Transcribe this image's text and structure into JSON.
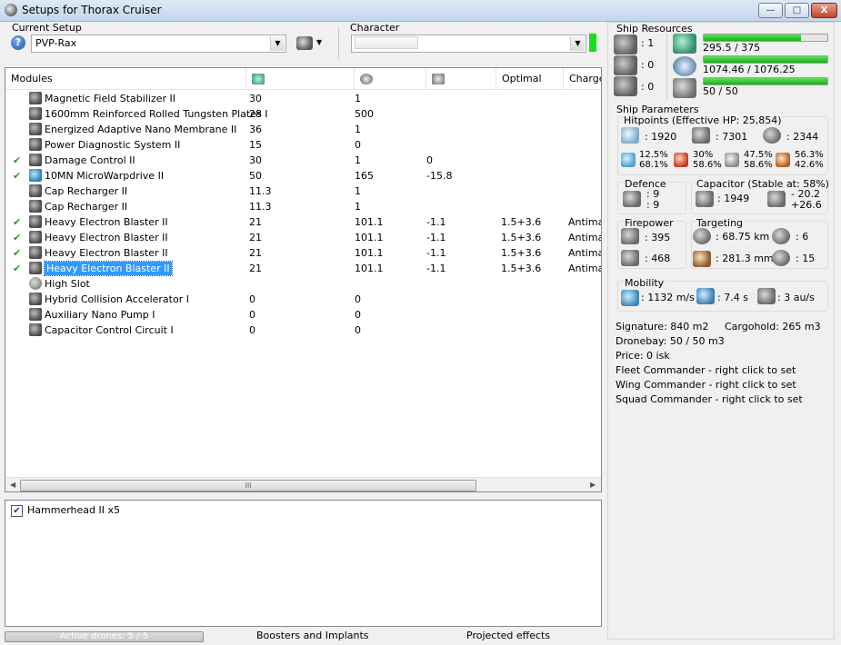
{
  "window": {
    "title": "Setups for Thorax Cruiser",
    "min_label": "—",
    "max_label": "□",
    "close_label": "X"
  },
  "setup": {
    "label": "Current Setup",
    "value": "PVP-Rax"
  },
  "character": {
    "label": "Character",
    "value": ""
  },
  "modules": {
    "columns": [
      "Modules",
      "",
      "",
      "",
      "Optimal",
      "Charge"
    ],
    "rows": [
      {
        "check": "",
        "name": "Magnetic Field Stabilizer II",
        "c1": "30",
        "c2": "1",
        "c3": "",
        "opt": "",
        "charge": "",
        "icon": "mag-stab-icon"
      },
      {
        "check": "",
        "name": "1600mm Reinforced Rolled Tungsten Plates I",
        "c1": "28",
        "c2": "500",
        "c3": "",
        "opt": "",
        "charge": "",
        "icon": "armor-plate-icon"
      },
      {
        "check": "",
        "name": "Energized Adaptive Nano Membrane II",
        "c1": "36",
        "c2": "1",
        "c3": "",
        "opt": "",
        "charge": "",
        "icon": "membrane-icon"
      },
      {
        "check": "",
        "name": "Power Diagnostic System II",
        "c1": "15",
        "c2": "0",
        "c3": "",
        "opt": "",
        "charge": "",
        "icon": "power-diag-icon"
      },
      {
        "check": "✔",
        "name": "Damage Control II",
        "c1": "30",
        "c2": "1",
        "c3": "0",
        "opt": "",
        "charge": "",
        "icon": "damage-control-icon"
      },
      {
        "check": "✔",
        "name": "10MN MicroWarpdrive II",
        "c1": "50",
        "c2": "165",
        "c3": "-15.8",
        "opt": "",
        "charge": "",
        "icon": "mwd-icon"
      },
      {
        "check": "",
        "name": "Cap Recharger II",
        "c1": "11.3",
        "c2": "1",
        "c3": "",
        "opt": "",
        "charge": "",
        "icon": "cap-recharger-icon"
      },
      {
        "check": "",
        "name": "Cap Recharger II",
        "c1": "11.3",
        "c2": "1",
        "c3": "",
        "opt": "",
        "charge": "",
        "icon": "cap-recharger-icon"
      },
      {
        "check": "✔",
        "name": "Heavy Electron Blaster II",
        "c1": "21",
        "c2": "101.1",
        "c3": "-1.1",
        "opt": "1.5+3.6",
        "charge": "Antimat",
        "icon": "blaster-icon"
      },
      {
        "check": "✔",
        "name": "Heavy Electron Blaster II",
        "c1": "21",
        "c2": "101.1",
        "c3": "-1.1",
        "opt": "1.5+3.6",
        "charge": "Antimat",
        "icon": "blaster-icon"
      },
      {
        "check": "✔",
        "name": "Heavy Electron Blaster II",
        "c1": "21",
        "c2": "101.1",
        "c3": "-1.1",
        "opt": "1.5+3.6",
        "charge": "Antimat",
        "icon": "blaster-icon"
      },
      {
        "check": "✔",
        "name": "Heavy Electron Blaster II",
        "c1": "21",
        "c2": "101.1",
        "c3": "-1.1",
        "opt": "1.5+3.6",
        "charge": "Antimat",
        "icon": "blaster-icon"
      },
      {
        "check": "",
        "name": "High Slot",
        "c1": "",
        "c2": "",
        "c3": "",
        "opt": "",
        "charge": "",
        "icon": "empty-slot-icon"
      },
      {
        "check": "",
        "name": "Hybrid Collision Accelerator I",
        "c1": "0",
        "c2": "0",
        "c3": "",
        "opt": "",
        "charge": "",
        "icon": "rig-icon"
      },
      {
        "check": "",
        "name": "Auxiliary Nano Pump I",
        "c1": "0",
        "c2": "0",
        "c3": "",
        "opt": "",
        "charge": "",
        "icon": "rig-icon"
      },
      {
        "check": "",
        "name": "Capacitor Control Circuit I",
        "c1": "0",
        "c2": "0",
        "c3": "",
        "opt": "",
        "charge": "",
        "icon": "rig-icon"
      }
    ],
    "scroll_grip": "III"
  },
  "drones": {
    "check": "✔",
    "label": "Hammerhead II x5"
  },
  "bottom": {
    "active_drones": "Active drones: 5 / 5",
    "active_drones_fill": 1.0,
    "boosters": "Boosters and Implants",
    "projected": "Projected effects"
  },
  "resources": {
    "title": "Ship Resources",
    "turret_slots": ": 1",
    "launcher_slots": ": 0",
    "calibration": ": 0",
    "cpu": "295.5 / 375",
    "cpu_fill": 0.79,
    "powergrid": "1074.46 / 1076.25",
    "powergrid_fill": 0.998,
    "drone_bay": "50 / 50",
    "drone_bay_fill": 1.0
  },
  "params": {
    "title": "Ship Parameters",
    "hitpoints": {
      "label": "Hitpoints (Effective HP: 25,854)",
      "shield": ": 1920",
      "armor": ": 7301",
      "structure": ": 2344",
      "em": [
        "12.5%",
        "68.1%"
      ],
      "thermal": [
        "30%",
        "58.6%"
      ],
      "kinetic": [
        "47.5%",
        "58.6%"
      ],
      "explosive": [
        "56.3%",
        "42.6%"
      ]
    },
    "defence": {
      "label": "Defence",
      "v1": ": 9",
      "v2": ": 9"
    },
    "capacitor": {
      "label": "Capacitor (Stable at: 58%)",
      "amount": ": 1949",
      "delta1": "- 20.2",
      "delta2": "+26.6"
    },
    "firepower": {
      "label": "Firepower",
      "dps": ": 395",
      "volley": ": 468"
    },
    "targeting": {
      "label": "Targeting",
      "range": ": 68.75 km",
      "targets": ": 6",
      "resolution": ": 281.3 mm",
      "scan": ": 15"
    },
    "mobility": {
      "label": "Mobility",
      "speed": ": 1132 m/s",
      "align": ": 7.4 s",
      "warp": ": 3 au/s"
    },
    "signature": "Signature: 840 m2",
    "cargohold": "Cargohold: 265 m3",
    "dronebay": "Dronebay: 50 / 50 m3",
    "price": "Price: 0 isk",
    "fleet_commander": "Fleet Commander - right click to set",
    "wing_commander": "Wing Commander - right click to set",
    "squad_commander": "Squad Commander - right click to set"
  }
}
